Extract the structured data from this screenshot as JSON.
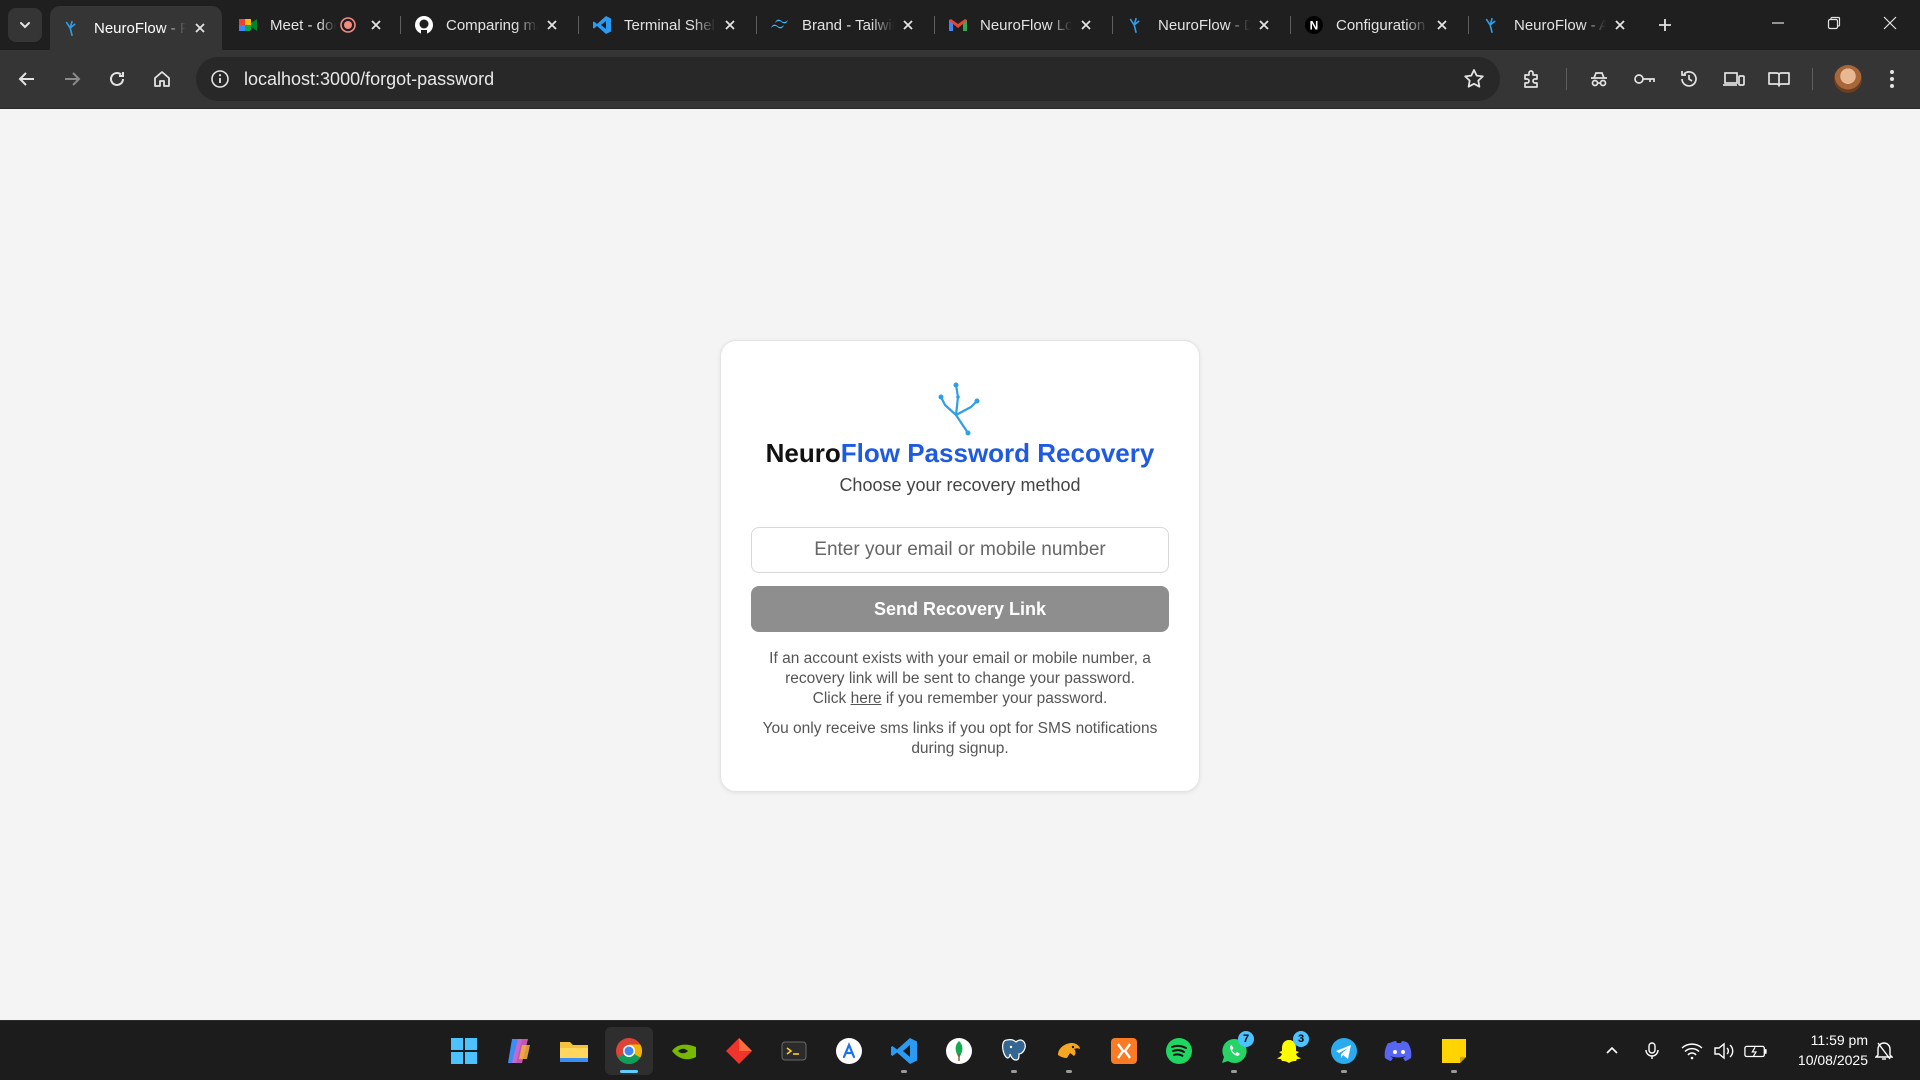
{
  "browser": {
    "tabs": [
      {
        "title": "NeuroFlow - Password Recovery",
        "icon": "neuroflow-icon",
        "active": true
      },
      {
        "title": "Meet - doc",
        "icon": "google-meet-icon",
        "recording": true
      },
      {
        "title": "Comparing main",
        "icon": "github-icon"
      },
      {
        "title": "Terminal Shell",
        "icon": "vscode-icon"
      },
      {
        "title": "Brand - Tailwind",
        "icon": "tailwind-icon"
      },
      {
        "title": "NeuroFlow Login",
        "icon": "gmail-icon"
      },
      {
        "title": "NeuroFlow - Dashboard",
        "icon": "neuroflow-icon"
      },
      {
        "title": "Configuration",
        "icon": "notion-icon"
      },
      {
        "title": "NeuroFlow - App",
        "icon": "neuroflow-icon"
      }
    ],
    "url": "localhost:3000/forgot-password"
  },
  "page": {
    "title_brand": "Neuro",
    "title_rest": "Flow Password Recovery",
    "subtitle": "Choose your recovery method",
    "input_placeholder": "Enter your email or mobile number",
    "submit_label": "Send Recovery Link",
    "info_text": "If an account exists with your email or mobile number, a recovery link will be sent to change your password.",
    "remember_prefix": "Click",
    "remember_link": "here",
    "remember_suffix": "if you remember your password.",
    "sms_note": "You only receive sms links if you opt for SMS notifications during signup."
  },
  "taskbar": {
    "apps": [
      {
        "name": "start-icon"
      },
      {
        "name": "copilot-icon"
      },
      {
        "name": "file-explorer-icon"
      },
      {
        "name": "chrome-icon",
        "active": true
      },
      {
        "name": "nvidia-icon"
      },
      {
        "name": "app-red-icon"
      },
      {
        "name": "terminal-icon"
      },
      {
        "name": "app-store-icon"
      },
      {
        "name": "vscode-icon",
        "running": true
      },
      {
        "name": "mongodb-icon"
      },
      {
        "name": "postgresql-icon",
        "running": true
      },
      {
        "name": "postman-icon",
        "running": true
      },
      {
        "name": "xampp-icon"
      },
      {
        "name": "spotify-icon"
      },
      {
        "name": "whatsapp-icon",
        "badge": "7",
        "running": true
      },
      {
        "name": "snapchat-icon",
        "badge": "3"
      },
      {
        "name": "telegram-icon",
        "running": true
      },
      {
        "name": "discord-icon"
      },
      {
        "name": "sticky-notes-icon",
        "running": true
      }
    ],
    "time": "11:59 pm",
    "date": "10/08/2025"
  },
  "colors": {
    "accent": "#1e5be0",
    "button_disabled": "#8e8e8e",
    "logo": "#2f9ee8"
  }
}
